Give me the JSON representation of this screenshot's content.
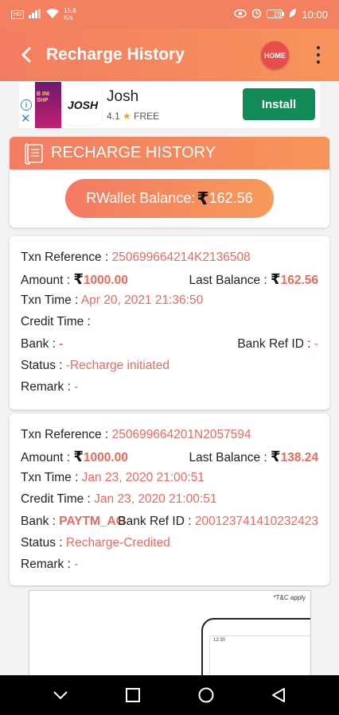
{
  "status_bar": {
    "hd_badge": "HD",
    "speed_value": "15.6",
    "speed_unit": "K/s",
    "battery": "28",
    "time": "10:00"
  },
  "app_bar": {
    "title": "Recharge History",
    "home_label": "HOME"
  },
  "ad": {
    "info": "i",
    "close": "✕",
    "thumb_text": "B INI SHP",
    "logo_text": "JOSH",
    "app_name": "Josh",
    "rating": "4.1",
    "price": "FREE",
    "install_label": "Install"
  },
  "summary": {
    "title": "RECHARGE HISTORY",
    "wallet_label": "RWallet Balance:",
    "rupee_symbol": "₹",
    "wallet_amount": "162.56"
  },
  "transactions": [
    {
      "ref_label": "Txn Reference : ",
      "ref_value": "250699664214K2136508",
      "amount_label": "Amount : ",
      "amount_value": "1000.00",
      "last_balance_label": "Last Balance : ",
      "last_balance_value": "162.56",
      "time_label": "Txn Time : ",
      "time_value": "Apr 20, 2021 21:36:50",
      "credit_label": "Credit Time : ",
      "credit_value": "",
      "bank_label": "Bank : ",
      "bank_value": "-",
      "bank_ref_label": "Bank Ref ID : ",
      "bank_ref_value": "-",
      "status_label": "Status : ",
      "status_value": " -Recharge initiated",
      "remark_label": "Remark : ",
      "remark_value": "-"
    },
    {
      "ref_label": "Txn Reference : ",
      "ref_value": "250699664201N2057594",
      "amount_label": "Amount : ",
      "amount_value": "1000.00",
      "last_balance_label": "Last Balance : ",
      "last_balance_value": "138.24",
      "time_label": "Txn Time : ",
      "time_value": "Jan 23, 2020 21:00:51",
      "credit_label": "Credit Time : ",
      "credit_value": "Jan 23, 2020 21:00:51",
      "bank_label": "Bank : ",
      "bank_value": "PAYTM_AG",
      "bank_ref_label": "Bank Ref ID : ",
      "bank_ref_value": "200123741410232423",
      "status_label": "Status : ",
      "status_value": "Recharge-Credited",
      "remark_label": "Remark : ",
      "remark_value": "-"
    }
  ],
  "banner": {
    "tc": "*T&C apply",
    "phone_time": "12:30"
  },
  "colors": {
    "accent": "#f37d62",
    "value_text": "#e46b5d",
    "install_green": "#128b56",
    "home_red": "#ea4b4b"
  }
}
